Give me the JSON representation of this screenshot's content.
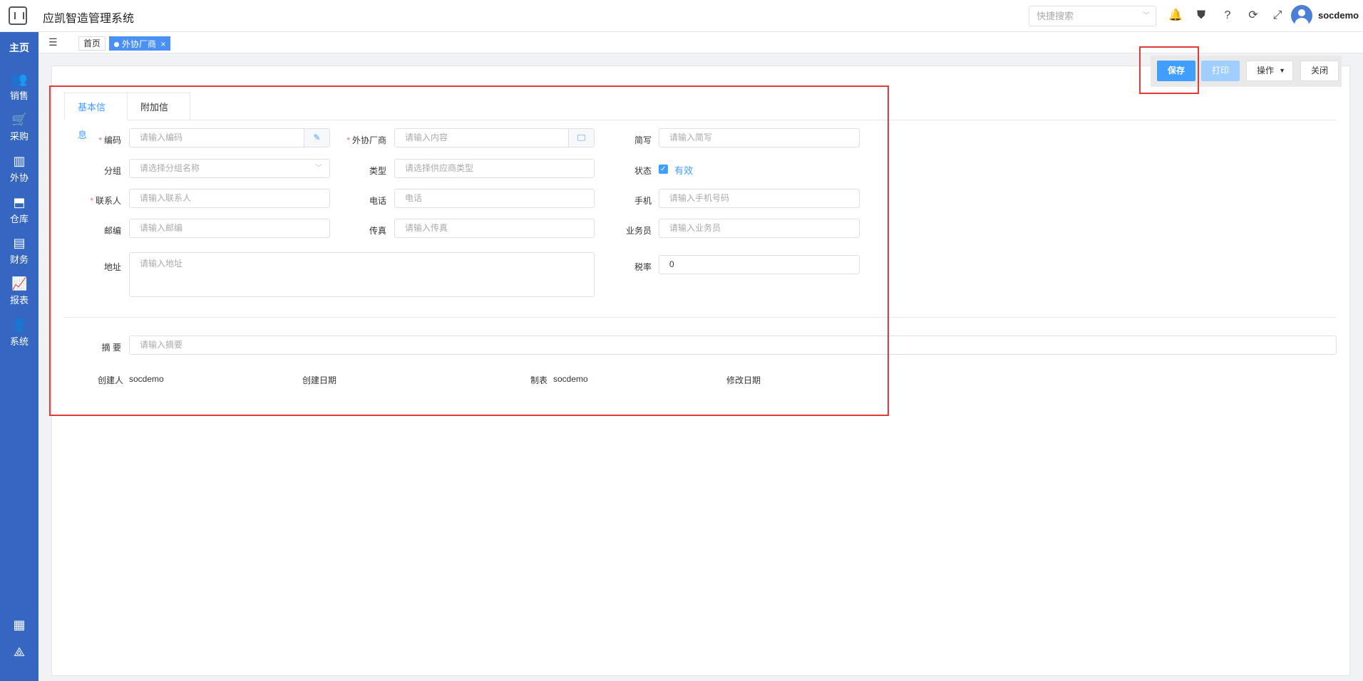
{
  "app": {
    "title": "应凯智造管理系统",
    "user": "socdemo"
  },
  "topbar": {
    "search_placeholder": "快捷搜索"
  },
  "sidebar": {
    "home": "主页",
    "items": [
      {
        "label": "销售",
        "icon": "users-icon"
      },
      {
        "label": "采购",
        "icon": "cart-icon"
      },
      {
        "label": "外协",
        "icon": "factory-icon"
      },
      {
        "label": "仓库",
        "icon": "warehouse-icon"
      },
      {
        "label": "财务",
        "icon": "finance-icon"
      },
      {
        "label": "报表",
        "icon": "chart-icon"
      },
      {
        "label": "系统",
        "icon": "user-icon"
      }
    ]
  },
  "tabs": {
    "home": "首页",
    "active": "外协厂商",
    "close": "×"
  },
  "toolbar": {
    "save": "保存",
    "print": "打印",
    "operate": "操作",
    "close": "关闭"
  },
  "form": {
    "tabs": [
      "基本信息",
      "附加信息"
    ],
    "fields": {
      "code": {
        "label": "编码",
        "placeholder": "请输入编码"
      },
      "vendor": {
        "label": "外协厂商",
        "placeholder": "请输入内容"
      },
      "abbr": {
        "label": "简写",
        "placeholder": "请输入简写"
      },
      "group": {
        "label": "分组",
        "placeholder": "请选择分组名称"
      },
      "type": {
        "label": "类型",
        "placeholder": "请选择供应商类型"
      },
      "status": {
        "label": "状态",
        "value": "有效"
      },
      "contact": {
        "label": "联系人",
        "placeholder": "请输入联系人"
      },
      "phone": {
        "label": "电话",
        "placeholder": "电话"
      },
      "mobile": {
        "label": "手机",
        "placeholder": "请输入手机号码"
      },
      "zip": {
        "label": "邮编",
        "placeholder": "请输入邮编"
      },
      "fax": {
        "label": "传真",
        "placeholder": "请输入传真"
      },
      "salesman": {
        "label": "业务员",
        "placeholder": "请输入业务员"
      },
      "address": {
        "label": "地址",
        "placeholder": "请输入地址"
      },
      "tax": {
        "label": "税率",
        "value": "0"
      },
      "summary": {
        "label": "摘 要",
        "placeholder": "请输入摘要"
      }
    },
    "meta": {
      "creator_label": "创建人",
      "creator": "socdemo",
      "created_label": "创建日期",
      "maker_label": "制表",
      "maker": "socdemo",
      "modified_label": "修改日期"
    }
  }
}
